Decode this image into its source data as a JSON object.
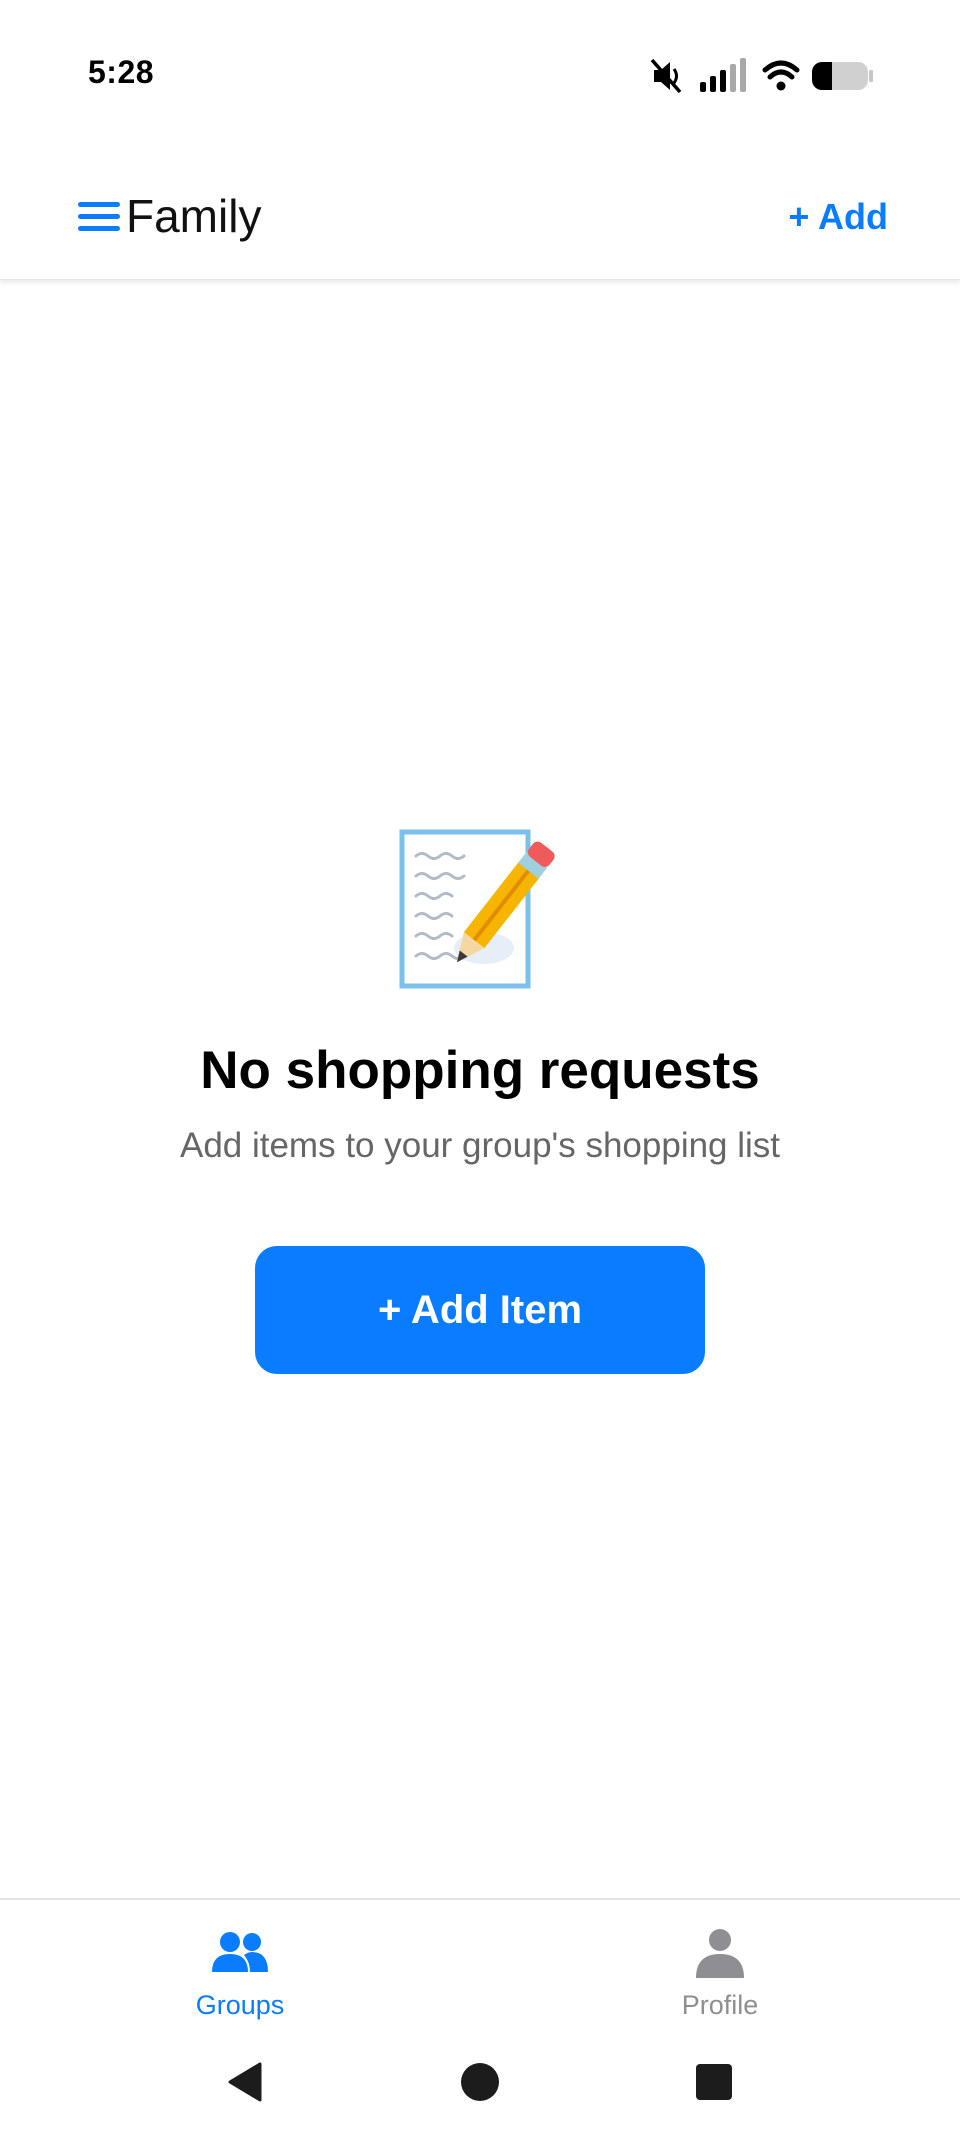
{
  "status_bar": {
    "time": "5:28",
    "icons": [
      "mute-icon",
      "signal-icon",
      "wifi-icon",
      "battery-icon"
    ]
  },
  "header": {
    "group_name": "Family",
    "add_label": "+ Add"
  },
  "empty_state": {
    "icon": "memo-icon",
    "title": "No shopping requests",
    "subtitle": "Add items to your group's shopping list",
    "button_label": "+ Add Item"
  },
  "tabs": [
    {
      "label": "Groups",
      "icon": "groups-icon",
      "active": true
    },
    {
      "label": "Profile",
      "icon": "profile-icon",
      "active": false
    }
  ],
  "nav_bar": {
    "buttons": [
      "back-icon",
      "home-icon",
      "recents-icon"
    ]
  },
  "colors": {
    "accent": "#0a7cff",
    "inactive": "#8e8e93",
    "subtitle": "#666666"
  }
}
